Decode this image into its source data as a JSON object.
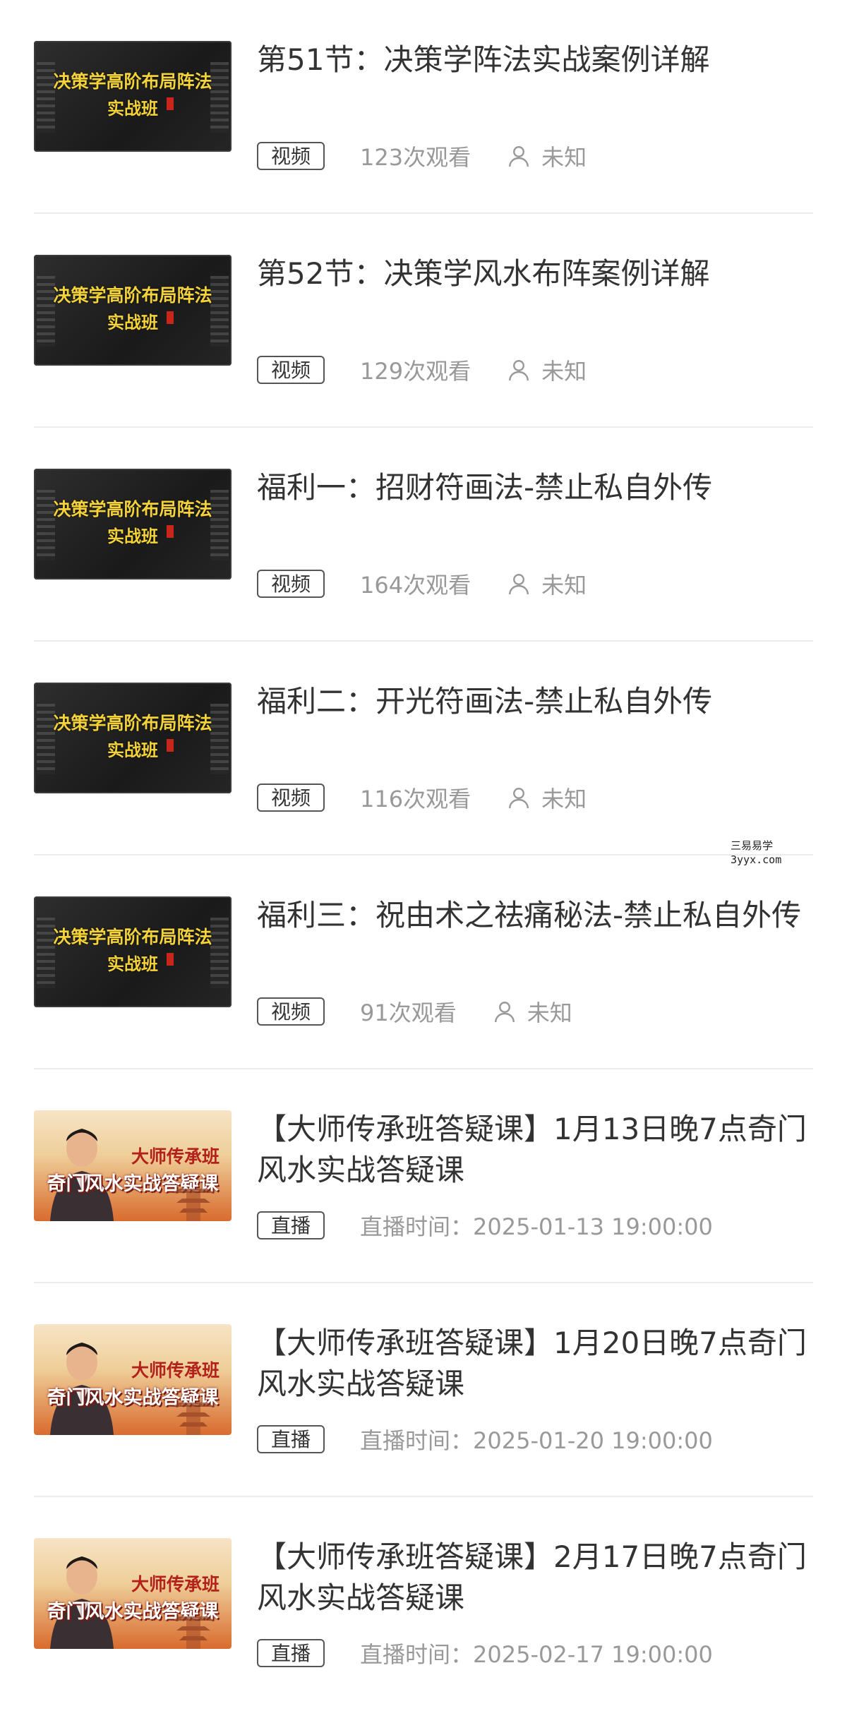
{
  "items": [
    {
      "thumb_line1": "决策学高阶布局阵法",
      "thumb_line2": "实战班",
      "title": "第51节：决策学阵法实战案例详解",
      "tag": "视频",
      "views": "123次观看",
      "author": "未知"
    },
    {
      "thumb_line1": "决策学高阶布局阵法",
      "thumb_line2": "实战班",
      "title": "第52节：决策学风水布阵案例详解",
      "tag": "视频",
      "views": "129次观看",
      "author": "未知"
    },
    {
      "thumb_line1": "决策学高阶布局阵法",
      "thumb_line2": "实战班",
      "title": "福利一：招财符画法-禁止私自外传",
      "tag": "视频",
      "views": "164次观看",
      "author": "未知"
    },
    {
      "thumb_line1": "决策学高阶布局阵法",
      "thumb_line2": "实战班",
      "title": "福利二：开光符画法-禁止私自外传",
      "tag": "视频",
      "views": "116次观看",
      "author": "未知"
    },
    {
      "thumb_line1": "决策学高阶布局阵法",
      "thumb_line2": "实战班",
      "title": "福利三：祝由术之祛痛秘法-禁止私自外传",
      "tag": "视频",
      "views": "91次观看",
      "author": "未知"
    },
    {
      "thumb_line1": "大师传承班",
      "thumb_line2": "奇门风水实战答疑课",
      "title": "【大师传承班答疑课】1月13日晚7点奇门风水实战答疑课",
      "tag": "直播",
      "time": "直播时间：2025-01-13 19:00:00"
    },
    {
      "thumb_line1": "大师传承班",
      "thumb_line2": "奇门风水实战答疑课",
      "title": "【大师传承班答疑课】1月20日晚7点奇门风水实战答疑课",
      "tag": "直播",
      "time": "直播时间：2025-01-20 19:00:00"
    },
    {
      "thumb_line1": "大师传承班",
      "thumb_line2": "奇门风水实战答疑课",
      "title": "【大师传承班答疑课】2月17日晚7点奇门风水实战答疑课",
      "tag": "直播",
      "time": "直播时间：2025-02-17 19:00:00"
    }
  ],
  "watermark": {
    "line1": "三易易学",
    "line2": "3yyx.com"
  },
  "colors": {
    "thumb_text": "#f3d23a",
    "meta_text": "#999999",
    "title_text": "#333333",
    "divider": "#ececec"
  }
}
